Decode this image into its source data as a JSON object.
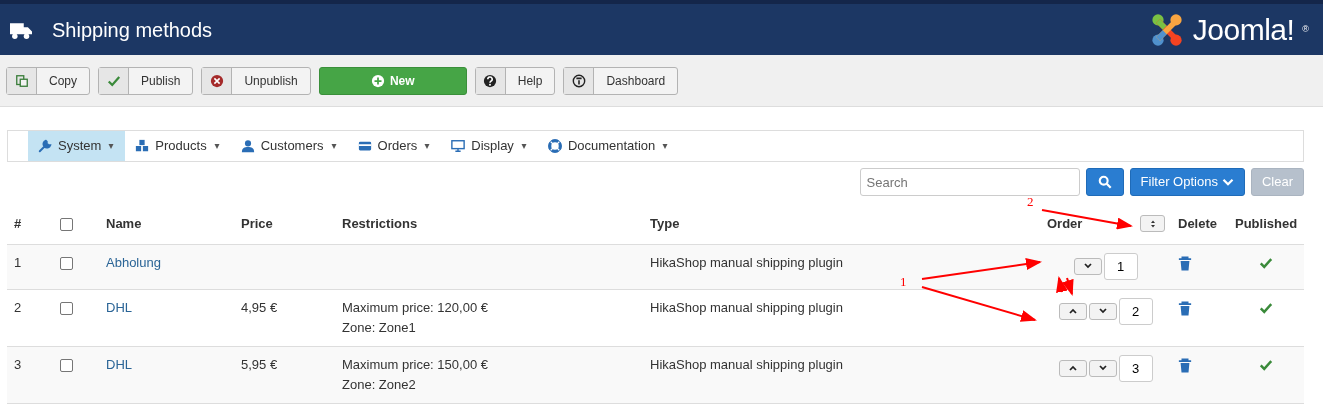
{
  "header": {
    "title": "Shipping methods",
    "logo_text": "Joomla!",
    "logo_mark": "®"
  },
  "toolbar": [
    {
      "label": "Copy",
      "kind": "default"
    },
    {
      "label": "Publish",
      "kind": "default"
    },
    {
      "label": "Unpublish",
      "kind": "default"
    },
    {
      "label": "New",
      "kind": "success"
    },
    {
      "label": "Help",
      "kind": "default"
    },
    {
      "label": "Dashboard",
      "kind": "default"
    }
  ],
  "menu": [
    {
      "label": "System",
      "selected": true
    },
    {
      "label": "Products",
      "selected": false
    },
    {
      "label": "Customers",
      "selected": false
    },
    {
      "label": "Orders",
      "selected": false
    },
    {
      "label": "Display",
      "selected": false
    },
    {
      "label": "Documentation",
      "selected": false
    }
  ],
  "filter": {
    "placeholder": "Search",
    "options_label": "Filter Options",
    "clear_label": "Clear"
  },
  "table": {
    "columns": [
      "#",
      "Name",
      "Price",
      "Restrictions",
      "Type",
      "Order",
      "Delete",
      "Published"
    ],
    "select_all": {
      "checked": false
    },
    "rows": [
      {
        "number": "1",
        "checked": false,
        "name": "Abholung",
        "price": "",
        "restrictions": [],
        "type": "HikaShop manual shipping plugin",
        "can_move_up": false,
        "can_move_down": true,
        "order": "1",
        "published": true
      },
      {
        "number": "2",
        "checked": false,
        "name": "DHL",
        "price": "4,95 €",
        "restrictions": [
          "Maximum price: 120,00 €",
          "Zone: Zone1"
        ],
        "type": "HikaShop manual shipping plugin",
        "can_move_up": true,
        "can_move_down": true,
        "order": "2",
        "published": true
      },
      {
        "number": "3",
        "checked": false,
        "name": "DHL",
        "price": "5,95 €",
        "restrictions": [
          "Maximum price: 150,00 €",
          "Zone: Zone2"
        ],
        "type": "HikaShop manual shipping plugin",
        "can_move_up": true,
        "can_move_down": true,
        "order": "3",
        "published": true
      }
    ]
  },
  "annotations": [
    {
      "label": "2"
    },
    {
      "label": "1"
    }
  ]
}
